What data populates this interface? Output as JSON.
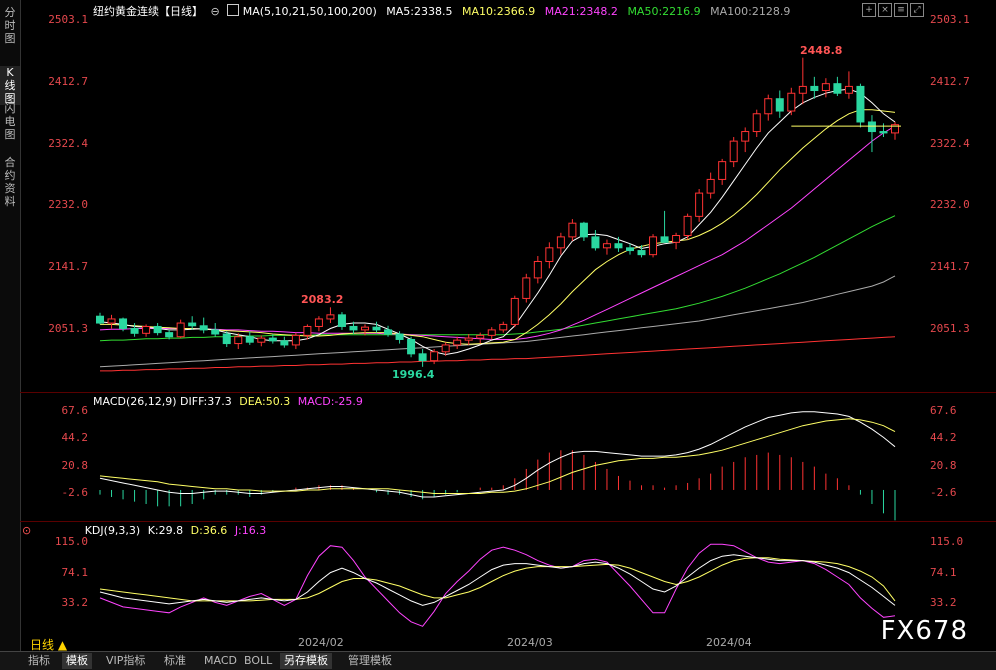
{
  "sidebar": {
    "tabs": [
      "分时图",
      "K线图",
      "闪电图",
      "合约资料"
    ],
    "active": 1
  },
  "header": {
    "title": "纽约黄金连续【日线】",
    "ma_label": "MA(5,10,21,50,100,200)",
    "ma5": "MA5:2338.5",
    "ma10": "MA10:2366.9",
    "ma21": "MA21:2348.2",
    "ma50": "MA50:2216.9",
    "ma100": "MA100:2128.9",
    "controls": [
      "plus-icon",
      "cross-icon",
      "menu-icon",
      "expand-icon"
    ]
  },
  "colors": {
    "up": "#ff3333",
    "down": "#2ad7a0",
    "ma5": "#ffffff",
    "ma10": "#ffff66",
    "ma21": "#ff44ff",
    "ma50": "#33dd33",
    "ma100": "#aaaaaa",
    "ma200": "#ff3333",
    "axis_text": "#e5484d",
    "diff": "#ffffff",
    "dea": "#ffff66",
    "macd": "#ff44ff",
    "k": "#ffffff",
    "d": "#ffff66",
    "j": "#ff44ff"
  },
  "price_axis": [
    "2503.1",
    "2412.7",
    "2322.4",
    "2232.0",
    "2141.7",
    "2051.3"
  ],
  "annotations": {
    "high": "2448.8",
    "mid": "2083.2",
    "low": "1996.4"
  },
  "macd": {
    "label": "MACD(26,12,9)",
    "diff": "DIFF:37.3",
    "dea": "DEA:50.3",
    "macd": "MACD:-25.9",
    "axis": [
      "67.6",
      "44.2",
      "20.8",
      "-2.6"
    ]
  },
  "kdj": {
    "label": "KDJ(9,3,3)",
    "k": "K:29.8",
    "d": "D:36.6",
    "j": "J:16.3",
    "axis": [
      "115.0",
      "74.1",
      "33.2"
    ]
  },
  "x_axis": [
    "2024/02",
    "2024/03",
    "2024/04"
  ],
  "period": "日线 ▲",
  "watermark": "FX678",
  "toolbar": [
    "指标",
    "模板",
    "VIP指标",
    "标准",
    "MACD",
    "BOLL",
    "另存模板",
    "管理模板"
  ],
  "toolbar_active": [
    1,
    6
  ],
  "chart_data": {
    "type": "candlestick",
    "candles": [
      [
        2070,
        2075,
        2058,
        2060
      ],
      [
        2060,
        2072,
        2052,
        2066
      ],
      [
        2066,
        2068,
        2048,
        2052
      ],
      [
        2052,
        2060,
        2040,
        2045
      ],
      [
        2045,
        2058,
        2040,
        2055
      ],
      [
        2055,
        2060,
        2042,
        2046
      ],
      [
        2046,
        2050,
        2036,
        2040
      ],
      [
        2040,
        2065,
        2038,
        2060
      ],
      [
        2060,
        2070,
        2050,
        2056
      ],
      [
        2056,
        2068,
        2045,
        2050
      ],
      [
        2050,
        2060,
        2040,
        2044
      ],
      [
        2044,
        2048,
        2025,
        2030
      ],
      [
        2030,
        2045,
        2022,
        2040
      ],
      [
        2040,
        2048,
        2028,
        2032
      ],
      [
        2032,
        2042,
        2026,
        2038
      ],
      [
        2038,
        2044,
        2030,
        2034
      ],
      [
        2034,
        2040,
        2024,
        2028
      ],
      [
        2028,
        2046,
        2022,
        2042
      ],
      [
        2042,
        2058,
        2036,
        2055
      ],
      [
        2055,
        2070,
        2048,
        2066
      ],
      [
        2066,
        2083,
        2060,
        2072
      ],
      [
        2072,
        2076,
        2050,
        2055
      ],
      [
        2055,
        2062,
        2044,
        2050
      ],
      [
        2050,
        2058,
        2042,
        2054
      ],
      [
        2054,
        2062,
        2046,
        2050
      ],
      [
        2050,
        2056,
        2040,
        2044
      ],
      [
        2044,
        2048,
        2030,
        2036
      ],
      [
        2036,
        2040,
        2010,
        2015
      ],
      [
        2015,
        2022,
        1996,
        2005
      ],
      [
        2005,
        2022,
        2000,
        2018
      ],
      [
        2018,
        2032,
        2012,
        2028
      ],
      [
        2028,
        2040,
        2022,
        2035
      ],
      [
        2035,
        2044,
        2028,
        2038
      ],
      [
        2038,
        2046,
        2030,
        2042
      ],
      [
        2042,
        2054,
        2036,
        2050
      ],
      [
        2050,
        2062,
        2046,
        2058
      ],
      [
        2058,
        2100,
        2054,
        2096
      ],
      [
        2096,
        2132,
        2090,
        2126
      ],
      [
        2126,
        2158,
        2118,
        2150
      ],
      [
        2150,
        2178,
        2140,
        2170
      ],
      [
        2170,
        2192,
        2160,
        2186
      ],
      [
        2186,
        2212,
        2180,
        2206
      ],
      [
        2206,
        2208,
        2180,
        2186
      ],
      [
        2186,
        2196,
        2166,
        2170
      ],
      [
        2170,
        2182,
        2160,
        2176
      ],
      [
        2176,
        2186,
        2164,
        2170
      ],
      [
        2170,
        2176,
        2160,
        2166
      ],
      [
        2166,
        2174,
        2156,
        2160
      ],
      [
        2160,
        2190,
        2156,
        2186
      ],
      [
        2186,
        2224,
        2180,
        2178
      ],
      [
        2178,
        2192,
        2168,
        2188
      ],
      [
        2188,
        2220,
        2182,
        2216
      ],
      [
        2216,
        2256,
        2208,
        2250
      ],
      [
        2250,
        2280,
        2242,
        2270
      ],
      [
        2270,
        2300,
        2262,
        2296
      ],
      [
        2296,
        2332,
        2288,
        2326
      ],
      [
        2326,
        2346,
        2310,
        2340
      ],
      [
        2340,
        2372,
        2332,
        2366
      ],
      [
        2366,
        2394,
        2356,
        2388
      ],
      [
        2388,
        2400,
        2360,
        2370
      ],
      [
        2370,
        2404,
        2364,
        2396
      ],
      [
        2396,
        2448,
        2380,
        2406
      ],
      [
        2406,
        2420,
        2388,
        2400
      ],
      [
        2400,
        2418,
        2390,
        2410
      ],
      [
        2410,
        2420,
        2392,
        2396
      ],
      [
        2396,
        2428,
        2388,
        2406
      ],
      [
        2406,
        2410,
        2346,
        2354
      ],
      [
        2354,
        2364,
        2310,
        2340
      ],
      [
        2340,
        2352,
        2332,
        2338
      ],
      [
        2338,
        2354,
        2328,
        2350
      ]
    ],
    "ma_lines": {
      "ma5": [
        2062,
        2060,
        2058,
        2055,
        2054,
        2052,
        2050,
        2050,
        2051,
        2052,
        2050,
        2046,
        2043,
        2040,
        2036,
        2034,
        2034,
        2034,
        2037,
        2043,
        2052,
        2058,
        2060,
        2060,
        2058,
        2051,
        2044,
        2036,
        2026,
        2018,
        2014,
        2017,
        2022,
        2028,
        2035,
        2040,
        2056,
        2080,
        2104,
        2130,
        2158,
        2180,
        2189,
        2190,
        2188,
        2182,
        2176,
        2169,
        2172,
        2176,
        2178,
        2186,
        2204,
        2222,
        2244,
        2268,
        2292,
        2316,
        2338,
        2354,
        2370,
        2382,
        2390,
        2396,
        2400,
        2402,
        2396,
        2382,
        2366,
        2354
      ],
      "ma10": [
        2058,
        2058,
        2057,
        2056,
        2055,
        2054,
        2053,
        2052,
        2052,
        2051,
        2050,
        2049,
        2048,
        2047,
        2046,
        2044,
        2043,
        2042,
        2041,
        2041,
        2042,
        2044,
        2045,
        2046,
        2046,
        2046,
        2044,
        2042,
        2040,
        2036,
        2032,
        2030,
        2029,
        2030,
        2031,
        2032,
        2036,
        2046,
        2058,
        2072,
        2088,
        2106,
        2122,
        2138,
        2150,
        2160,
        2168,
        2172,
        2176,
        2178,
        2180,
        2182,
        2188,
        2196,
        2206,
        2218,
        2232,
        2248,
        2266,
        2284,
        2300,
        2316,
        2330,
        2344,
        2356,
        2366,
        2372,
        2372,
        2370,
        2368
      ],
      "ma21": [
        2050,
        2051,
        2051,
        2052,
        2052,
        2052,
        2052,
        2052,
        2052,
        2051,
        2051,
        2050,
        2050,
        2049,
        2048,
        2048,
        2047,
        2046,
        2046,
        2045,
        2045,
        2045,
        2045,
        2045,
        2045,
        2044,
        2044,
        2043,
        2042,
        2041,
        2040,
        2039,
        2038,
        2037,
        2036,
        2036,
        2036,
        2038,
        2041,
        2045,
        2050,
        2057,
        2064,
        2072,
        2080,
        2088,
        2096,
        2104,
        2112,
        2120,
        2128,
        2136,
        2144,
        2152,
        2160,
        2170,
        2180,
        2192,
        2204,
        2216,
        2228,
        2242,
        2256,
        2270,
        2284,
        2298,
        2312,
        2326,
        2338,
        2348
      ],
      "ma50": [
        2034,
        2035,
        2035,
        2036,
        2037,
        2037,
        2038,
        2038,
        2039,
        2039,
        2040,
        2040,
        2041,
        2041,
        2041,
        2042,
        2042,
        2042,
        2042,
        2043,
        2043,
        2043,
        2043,
        2043,
        2043,
        2043,
        2043,
        2043,
        2043,
        2043,
        2043,
        2043,
        2043,
        2043,
        2043,
        2043,
        2044,
        2045,
        2047,
        2049,
        2051,
        2054,
        2057,
        2060,
        2063,
        2066,
        2069,
        2072,
        2075,
        2078,
        2081,
        2085,
        2089,
        2094,
        2099,
        2105,
        2111,
        2118,
        2125,
        2132,
        2140,
        2148,
        2156,
        2165,
        2174,
        2183,
        2192,
        2201,
        2209,
        2217
      ],
      "ma100": [
        1996,
        1997,
        1998,
        1999,
        2000,
        2001,
        2002,
        2003,
        2004,
        2005,
        2006,
        2007,
        2008,
        2009,
        2010,
        2011,
        2012,
        2013,
        2014,
        2015,
        2016,
        2017,
        2018,
        2019,
        2020,
        2021,
        2022,
        2023,
        2024,
        2025,
        2026,
        2027,
        2028,
        2029,
        2030,
        2031,
        2032,
        2033,
        2035,
        2037,
        2039,
        2041,
        2043,
        2045,
        2047,
        2049,
        2051,
        2053,
        2055,
        2057,
        2059,
        2061,
        2063,
        2066,
        2069,
        2072,
        2075,
        2078,
        2081,
        2084,
        2087,
        2090,
        2094,
        2098,
        2102,
        2106,
        2110,
        2114,
        2120,
        2129
      ],
      "ma200": [
        1990,
        1990,
        1991,
        1991,
        1992,
        1992,
        1993,
        1993,
        1994,
        1994,
        1995,
        1995,
        1996,
        1996,
        1997,
        1997,
        1998,
        1998,
        1999,
        1999,
        2000,
        2000,
        2001,
        2001,
        2002,
        2002,
        2003,
        2003,
        2004,
        2004,
        2005,
        2005,
        2006,
        2006,
        2007,
        2007,
        2008,
        2008,
        2009,
        2010,
        2011,
        2012,
        2013,
        2014,
        2015,
        2016,
        2017,
        2018,
        2019,
        2020,
        2021,
        2022,
        2023,
        2024,
        2025,
        2026,
        2027,
        2028,
        2029,
        2030,
        2031,
        2032,
        2033,
        2034,
        2035,
        2036,
        2037,
        2038,
        2039,
        2040
      ]
    },
    "macd": {
      "diff": [
        10,
        8,
        6,
        4,
        2,
        0,
        -2,
        -3,
        -3,
        -2,
        -1,
        -1,
        -2,
        -3,
        -3,
        -2,
        -1,
        0,
        1,
        2,
        3,
        3,
        2,
        1,
        0,
        -1,
        -2,
        -4,
        -6,
        -6,
        -5,
        -4,
        -3,
        -2,
        -1,
        0,
        4,
        10,
        17,
        23,
        28,
        32,
        33,
        33,
        32,
        31,
        30,
        29,
        29,
        29,
        30,
        32,
        35,
        39,
        44,
        49,
        54,
        58,
        62,
        64,
        66,
        67,
        67,
        66,
        65,
        63,
        58,
        52,
        45,
        37
      ],
      "dea": [
        12,
        11,
        10,
        9,
        8,
        7,
        5,
        4,
        3,
        2,
        1,
        1,
        0,
        0,
        -1,
        -1,
        -1,
        -1,
        0,
        0,
        1,
        1,
        1,
        1,
        1,
        1,
        0,
        -1,
        -2,
        -3,
        -3,
        -3,
        -3,
        -3,
        -2,
        -2,
        -1,
        1,
        4,
        7,
        11,
        15,
        18,
        21,
        23,
        25,
        26,
        27,
        27,
        28,
        28,
        29,
        30,
        32,
        34,
        37,
        40,
        43,
        46,
        49,
        52,
        55,
        57,
        59,
        60,
        61,
        60,
        58,
        55,
        50
      ],
      "macd": [
        -4,
        -6,
        -8,
        -10,
        -12,
        -14,
        -14,
        -14,
        -12,
        -8,
        -4,
        -4,
        -4,
        -6,
        -4,
        -2,
        0,
        2,
        2,
        4,
        4,
        4,
        2,
        0,
        -2,
        -4,
        -4,
        -6,
        -8,
        -6,
        -4,
        -2,
        0,
        2,
        2,
        4,
        10,
        18,
        26,
        32,
        34,
        34,
        30,
        24,
        18,
        12,
        8,
        4,
        4,
        2,
        4,
        6,
        10,
        14,
        20,
        24,
        28,
        30,
        32,
        30,
        28,
        24,
        20,
        14,
        10,
        4,
        -4,
        -12,
        -20,
        -26
      ]
    },
    "kdj": {
      "k": [
        48,
        44,
        40,
        38,
        36,
        34,
        32,
        34,
        36,
        38,
        36,
        34,
        36,
        38,
        40,
        38,
        36,
        38,
        48,
        62,
        74,
        80,
        74,
        66,
        60,
        52,
        44,
        36,
        30,
        34,
        42,
        50,
        58,
        68,
        78,
        84,
        86,
        86,
        84,
        82,
        80,
        82,
        86,
        88,
        86,
        80,
        72,
        62,
        52,
        48,
        56,
        68,
        80,
        90,
        96,
        98,
        96,
        94,
        92,
        90,
        90,
        90,
        88,
        84,
        80,
        74,
        64,
        54,
        42,
        30
      ],
      "d": [
        52,
        50,
        48,
        46,
        44,
        42,
        40,
        38,
        36,
        36,
        36,
        36,
        36,
        36,
        37,
        38,
        38,
        38,
        40,
        46,
        54,
        62,
        66,
        66,
        64,
        60,
        56,
        50,
        44,
        40,
        40,
        44,
        48,
        54,
        62,
        70,
        76,
        80,
        82,
        82,
        82,
        82,
        83,
        84,
        85,
        84,
        80,
        74,
        68,
        62,
        58,
        62,
        68,
        76,
        84,
        90,
        93,
        94,
        94,
        92,
        91,
        90,
        89,
        88,
        86,
        82,
        76,
        68,
        56,
        36
      ],
      "j": [
        40,
        34,
        28,
        26,
        24,
        22,
        20,
        28,
        34,
        40,
        34,
        30,
        36,
        42,
        46,
        38,
        30,
        38,
        70,
        96,
        110,
        108,
        90,
        68,
        52,
        36,
        20,
        8,
        2,
        22,
        46,
        62,
        76,
        92,
        104,
        108,
        104,
        98,
        90,
        84,
        80,
        82,
        90,
        92,
        88,
        72,
        56,
        38,
        20,
        20,
        52,
        80,
        100,
        112,
        112,
        110,
        102,
        94,
        88,
        86,
        88,
        90,
        86,
        78,
        68,
        58,
        40,
        26,
        14,
        16
      ]
    }
  }
}
